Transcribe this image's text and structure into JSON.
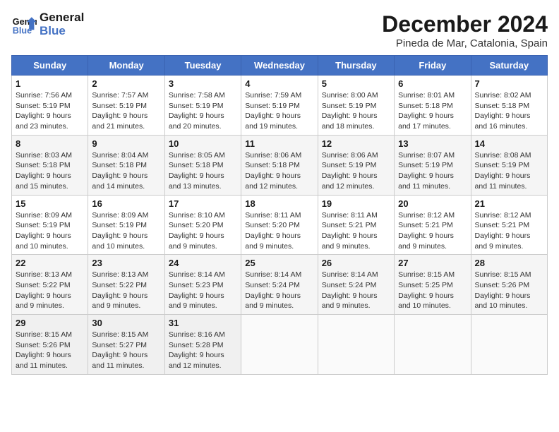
{
  "header": {
    "logo_line1": "General",
    "logo_line2": "Blue",
    "month_title": "December 2024",
    "subtitle": "Pineda de Mar, Catalonia, Spain"
  },
  "weekdays": [
    "Sunday",
    "Monday",
    "Tuesday",
    "Wednesday",
    "Thursday",
    "Friday",
    "Saturday"
  ],
  "weeks": [
    [
      {
        "day": "1",
        "sunrise": "7:56 AM",
        "sunset": "5:19 PM",
        "daylight": "9 hours and 23 minutes."
      },
      {
        "day": "2",
        "sunrise": "7:57 AM",
        "sunset": "5:19 PM",
        "daylight": "9 hours and 21 minutes."
      },
      {
        "day": "3",
        "sunrise": "7:58 AM",
        "sunset": "5:19 PM",
        "daylight": "9 hours and 20 minutes."
      },
      {
        "day": "4",
        "sunrise": "7:59 AM",
        "sunset": "5:19 PM",
        "daylight": "9 hours and 19 minutes."
      },
      {
        "day": "5",
        "sunrise": "8:00 AM",
        "sunset": "5:19 PM",
        "daylight": "9 hours and 18 minutes."
      },
      {
        "day": "6",
        "sunrise": "8:01 AM",
        "sunset": "5:18 PM",
        "daylight": "9 hours and 17 minutes."
      },
      {
        "day": "7",
        "sunrise": "8:02 AM",
        "sunset": "5:18 PM",
        "daylight": "9 hours and 16 minutes."
      }
    ],
    [
      {
        "day": "8",
        "sunrise": "8:03 AM",
        "sunset": "5:18 PM",
        "daylight": "9 hours and 15 minutes."
      },
      {
        "day": "9",
        "sunrise": "8:04 AM",
        "sunset": "5:18 PM",
        "daylight": "9 hours and 14 minutes."
      },
      {
        "day": "10",
        "sunrise": "8:05 AM",
        "sunset": "5:18 PM",
        "daylight": "9 hours and 13 minutes."
      },
      {
        "day": "11",
        "sunrise": "8:06 AM",
        "sunset": "5:18 PM",
        "daylight": "9 hours and 12 minutes."
      },
      {
        "day": "12",
        "sunrise": "8:06 AM",
        "sunset": "5:19 PM",
        "daylight": "9 hours and 12 minutes."
      },
      {
        "day": "13",
        "sunrise": "8:07 AM",
        "sunset": "5:19 PM",
        "daylight": "9 hours and 11 minutes."
      },
      {
        "day": "14",
        "sunrise": "8:08 AM",
        "sunset": "5:19 PM",
        "daylight": "9 hours and 11 minutes."
      }
    ],
    [
      {
        "day": "15",
        "sunrise": "8:09 AM",
        "sunset": "5:19 PM",
        "daylight": "9 hours and 10 minutes."
      },
      {
        "day": "16",
        "sunrise": "8:09 AM",
        "sunset": "5:19 PM",
        "daylight": "9 hours and 10 minutes."
      },
      {
        "day": "17",
        "sunrise": "8:10 AM",
        "sunset": "5:20 PM",
        "daylight": "9 hours and 9 minutes."
      },
      {
        "day": "18",
        "sunrise": "8:11 AM",
        "sunset": "5:20 PM",
        "daylight": "9 hours and 9 minutes."
      },
      {
        "day": "19",
        "sunrise": "8:11 AM",
        "sunset": "5:21 PM",
        "daylight": "9 hours and 9 minutes."
      },
      {
        "day": "20",
        "sunrise": "8:12 AM",
        "sunset": "5:21 PM",
        "daylight": "9 hours and 9 minutes."
      },
      {
        "day": "21",
        "sunrise": "8:12 AM",
        "sunset": "5:21 PM",
        "daylight": "9 hours and 9 minutes."
      }
    ],
    [
      {
        "day": "22",
        "sunrise": "8:13 AM",
        "sunset": "5:22 PM",
        "daylight": "9 hours and 9 minutes."
      },
      {
        "day": "23",
        "sunrise": "8:13 AM",
        "sunset": "5:22 PM",
        "daylight": "9 hours and 9 minutes."
      },
      {
        "day": "24",
        "sunrise": "8:14 AM",
        "sunset": "5:23 PM",
        "daylight": "9 hours and 9 minutes."
      },
      {
        "day": "25",
        "sunrise": "8:14 AM",
        "sunset": "5:24 PM",
        "daylight": "9 hours and 9 minutes."
      },
      {
        "day": "26",
        "sunrise": "8:14 AM",
        "sunset": "5:24 PM",
        "daylight": "9 hours and 9 minutes."
      },
      {
        "day": "27",
        "sunrise": "8:15 AM",
        "sunset": "5:25 PM",
        "daylight": "9 hours and 10 minutes."
      },
      {
        "day": "28",
        "sunrise": "8:15 AM",
        "sunset": "5:26 PM",
        "daylight": "9 hours and 10 minutes."
      }
    ],
    [
      {
        "day": "29",
        "sunrise": "8:15 AM",
        "sunset": "5:26 PM",
        "daylight": "9 hours and 11 minutes."
      },
      {
        "day": "30",
        "sunrise": "8:15 AM",
        "sunset": "5:27 PM",
        "daylight": "9 hours and 11 minutes."
      },
      {
        "day": "31",
        "sunrise": "8:16 AM",
        "sunset": "5:28 PM",
        "daylight": "9 hours and 12 minutes."
      },
      null,
      null,
      null,
      null
    ]
  ]
}
